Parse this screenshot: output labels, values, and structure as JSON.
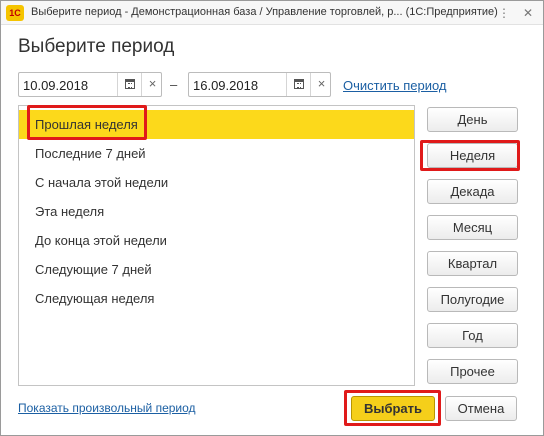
{
  "titlebar": {
    "app_logo": "1С",
    "title": "Выберите период - Демонстрационная база / Управление торговлей, р...  (1С:Предприятие)",
    "more_icon": "⋮",
    "close_icon": "✕"
  },
  "heading": "Выберите период",
  "date_from": {
    "value": "10.09.2018",
    "clear_icon": "×"
  },
  "date_separator": "–",
  "date_to": {
    "value": "16.09.2018",
    "clear_icon": "×"
  },
  "clear_period_label": "Очистить период",
  "period_list": {
    "selected_index": 0,
    "items": [
      "Прошлая неделя",
      "Последние 7 дней",
      "С начала этой недели",
      "Эта неделя",
      "До конца этой недели",
      "Следующие 7 дней",
      "Следующая неделя"
    ]
  },
  "period_types": [
    "День",
    "Неделя",
    "Декада",
    "Месяц",
    "Квартал",
    "Полугодие",
    "Год",
    "Прочее"
  ],
  "footer": {
    "arbitrary_period_label": "Показать произвольный период",
    "choose_label": "Выбрать",
    "cancel_label": "Отмена"
  },
  "colors": {
    "selection": "#fcd91b",
    "default_button": "#f5cf1a",
    "highlight_frame": "#e01a1a",
    "link": "#1b5fa3"
  }
}
